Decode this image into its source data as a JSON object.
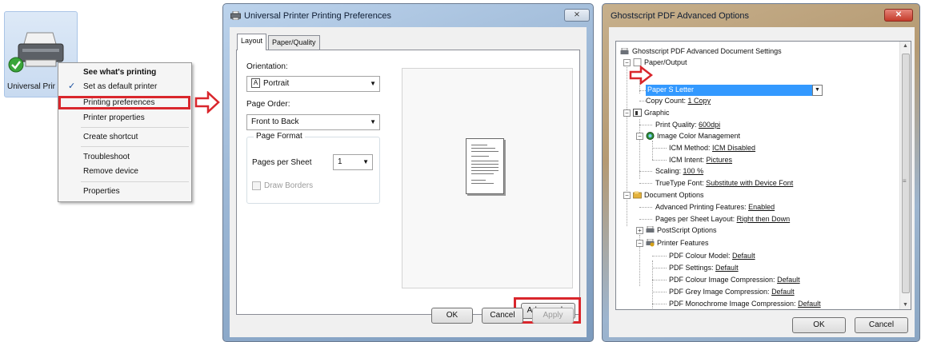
{
  "desktop": {
    "printer_label": "Universal Prir"
  },
  "context_menu": {
    "items": [
      {
        "label": "See what's printing",
        "bold": true
      },
      {
        "label": "Set as default printer",
        "checked": true
      },
      {
        "label": "Printing preferences",
        "highlighted": true
      },
      {
        "label": "Printer properties"
      },
      {
        "label": "Create shortcut"
      },
      {
        "label": "Troubleshoot"
      },
      {
        "label": "Remove device"
      },
      {
        "label": "Properties"
      }
    ],
    "check_glyph": "✓"
  },
  "preferences": {
    "title": "Universal Printer Printing Preferences",
    "close_glyph": "⨯",
    "tabs": [
      "Layout",
      "Paper/Quality"
    ],
    "orientation_label": "Orientation:",
    "orientation_value": "Portrait",
    "orientation_icon": "A",
    "page_order_label": "Page Order:",
    "page_order_value": "Front to Back",
    "page_format_label": "Page Format",
    "pages_per_sheet_label": "Pages per Sheet",
    "pages_per_sheet_value": "1",
    "draw_borders_label": "Draw Borders",
    "advanced_button": "Advanced...",
    "ok_button": "OK",
    "cancel_button": "Cancel",
    "apply_button": "Apply",
    "dropdown_glyph": "▼"
  },
  "advanced": {
    "title": "Ghostscript PDF Advanced Options",
    "close_glyph": "✕",
    "tree": {
      "root": "Ghostscript PDF Advanced Document Settings",
      "paper_output": "Paper/Output",
      "paper_size_label": "Paper Size:",
      "paper_size_value": "Letter",
      "copy_count_label": "Copy Count:",
      "copy_count_value": "1 Copy",
      "graphic": "Graphic",
      "print_quality_label": "Print Quality:",
      "print_quality_value": "600dpi",
      "icm": "Image Color Management",
      "icm_method_label": "ICM Method:",
      "icm_method_value": "ICM Disabled",
      "icm_intent_label": "ICM Intent:",
      "icm_intent_value": "Pictures",
      "scaling_label": "Scaling:",
      "scaling_value": "100 %",
      "truetype_label": "TrueType Font:",
      "truetype_value": "Substitute with Device Font",
      "document_options": "Document Options",
      "adv_features_label": "Advanced Printing Features:",
      "adv_features_value": "Enabled",
      "pps_layout_label": "Pages per Sheet Layout:",
      "pps_layout_value": "Right then Down",
      "postscript_options": "PostScript Options",
      "printer_features": "Printer Features",
      "pdf_colour_model_label": "PDF Colour Model:",
      "pdf_colour_model_value": "Default",
      "pdf_settings_label": "PDF Settings:",
      "pdf_settings_value": "Default",
      "pdf_colour_img_label": "PDF Colour Image Compression:",
      "pdf_colour_img_value": "Default",
      "pdf_grey_img_label": "PDF Grey Image Compression:",
      "pdf_grey_img_value": "Default",
      "pdf_mono_img_label": "PDF Monochrome Image Compression:",
      "pdf_mono_img_value": "Default"
    },
    "ok_button": "OK",
    "cancel_button": "Cancel",
    "expand_minus": "−",
    "expand_plus": "+",
    "scroll_up": "▲",
    "scroll_down": "▼",
    "scroll_grip": "≡"
  },
  "colors": {
    "highlight_red": "#d9262c",
    "selection_blue": "#3399ff"
  }
}
